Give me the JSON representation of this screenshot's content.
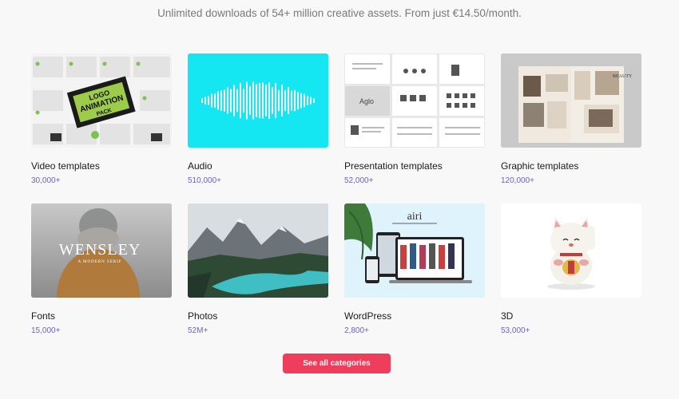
{
  "header": {
    "subtitle": "Unlimited downloads of 54+ million creative assets. From just €14.50/month."
  },
  "categories": [
    {
      "title": "Video templates",
      "count": "30,000+",
      "thumb_text": [
        "LOGO",
        "ANIMATION",
        "PACK"
      ],
      "icon": "video-templates-thumbnail"
    },
    {
      "title": "Audio",
      "count": "510,000+",
      "icon": "audio-waveform-thumbnail"
    },
    {
      "title": "Presentation templates",
      "count": "52,000+",
      "thumb_text": "Aglo",
      "icon": "presentation-templates-thumbnail"
    },
    {
      "title": "Graphic templates",
      "count": "120,000+",
      "thumb_text": "BEAUTY",
      "icon": "graphic-templates-thumbnail"
    },
    {
      "title": "Fonts",
      "count": "15,000+",
      "thumb_text": "WENSLEY",
      "thumb_subtext": "A MODERN SERIF",
      "icon": "fonts-thumbnail"
    },
    {
      "title": "Photos",
      "count": "52M+",
      "icon": "photos-thumbnail"
    },
    {
      "title": "WordPress",
      "count": "2,800+",
      "thumb_text": "airi",
      "icon": "wordpress-thumbnail"
    },
    {
      "title": "3D",
      "count": "53,000+",
      "icon": "3d-thumbnail"
    }
  ],
  "cta": {
    "label": "See all categories"
  },
  "colors": {
    "accent": "#ef3e5b",
    "count": "#6f5fc7",
    "audio_bg": "#14e6f2"
  }
}
